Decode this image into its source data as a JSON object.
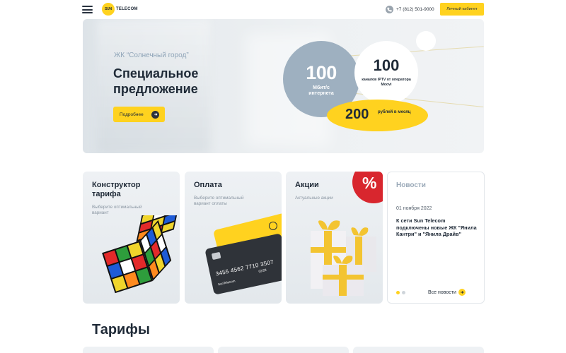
{
  "header": {
    "logo_mark": "SUN",
    "logo_word": "TELECOM",
    "phone": "+7 (812) 501-9000",
    "cabinet_label": "Личный кабинет"
  },
  "hero": {
    "subtitle": "ЖК “Солнечный город”",
    "title": "Специальное предложение",
    "button_label": "Подробнее",
    "speed_value": "100",
    "speed_text": "Мбит/с интернета",
    "tv_value": "100",
    "tv_text": "каналов IPTV от оператора Moovi",
    "price_value": "200",
    "price_text": "рублей в месяц"
  },
  "cards": {
    "constructor": {
      "title": "Конструктор тарифа",
      "desc": "Выберите оптимальный вариант"
    },
    "payment": {
      "title": "Оплата",
      "desc": "Выберите оптимальный вариант оплаты",
      "card_number": "3455 4562 7710 3507",
      "card_name": "SunTelecom",
      "card_expiry": "02/28"
    },
    "promo": {
      "title": "Акции",
      "desc": "Актуальные акции",
      "badge": "%"
    },
    "news": {
      "title": "Новости",
      "date": "01 ноября 2022",
      "text": "К сети Sun Telecom подключены новые ЖК \"Янила Кантри\" и \"Янила Драйв\"",
      "all_label": "Все новости"
    }
  },
  "tariffs": {
    "title": "Тарифы"
  },
  "colors": {
    "accent": "#ffd21f",
    "dark": "#1f2a37",
    "sale": "#d8262e",
    "muted": "#9eb0c0"
  }
}
